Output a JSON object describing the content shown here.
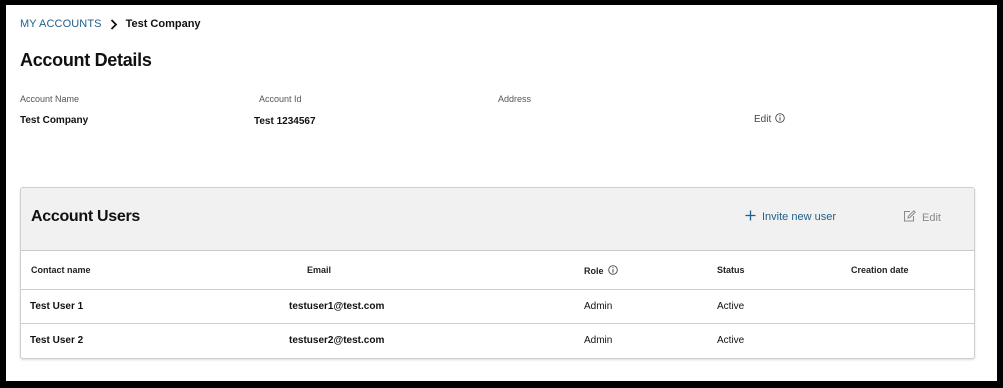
{
  "breadcrumb": {
    "root": "MY ACCOUNTS",
    "current": "Test Company"
  },
  "account_details": {
    "title": "Account Details",
    "fields": [
      {
        "label": "Account Name",
        "value": "Test Company"
      },
      {
        "label": "Account Id",
        "value": "Test 1234567"
      },
      {
        "label": "Address",
        "value": ""
      }
    ],
    "edit_label": "Edit"
  },
  "account_users": {
    "title": "Account Users",
    "invite_label": "Invite new user",
    "edit_label": "Edit",
    "columns": {
      "contact": "Contact name",
      "email": "Email",
      "role": "Role",
      "status": "Status",
      "created": "Creation date"
    },
    "rows": [
      {
        "contact": "Test User 1",
        "email": "testuser1@test.com",
        "role": "Admin",
        "status": "Active",
        "created": ""
      },
      {
        "contact": "Test User 2",
        "email": "testuser2@test.com",
        "role": "Admin",
        "status": "Active",
        "created": ""
      }
    ]
  },
  "colors": {
    "link": "#1f5f8b",
    "header_bg": "#f1f1f1",
    "frame": "#000000",
    "muted": "#8a8a8a"
  },
  "icons": {
    "breadcrumb_separator": "chevron-right-icon",
    "info": "info-icon",
    "invite": "plus-icon",
    "edit": "edit-icon"
  }
}
